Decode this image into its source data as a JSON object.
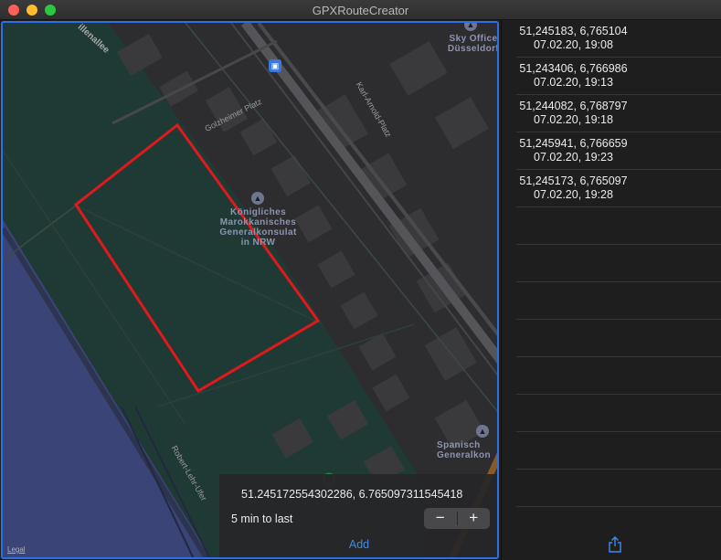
{
  "window": {
    "title": "GPXRouteCreator"
  },
  "map": {
    "labels": {
      "consulate": [
        "Königliches",
        "Marokkanisches",
        "Generalkonsulat",
        "in NRW"
      ],
      "sky_office": [
        "Sky Office",
        "Düsseldorf"
      ],
      "spanish": [
        "Spanisch",
        "Generalkon"
      ]
    },
    "streets": {
      "allee": "illenallee",
      "golzheimer": "Golzheimer Platz",
      "karl_arnold": "Karl-Arnold-Platz",
      "robert_lehr": "Robert-Lehr-Ufer"
    },
    "legal": "Legal",
    "colors": {
      "route": "#e0191c",
      "accent": "#2f6fe6",
      "water": "#3a4476",
      "park": "#1f3a35"
    }
  },
  "overlay": {
    "coordinate": "51.245172554302286, 6.765097311545418",
    "interval": "5 min to last",
    "stepper_minus": "−",
    "stepper_plus": "+",
    "add_label": "Add"
  },
  "waypoints": [
    {
      "coord": "51,245183, 6,765104",
      "time": "07.02.20, 19:08"
    },
    {
      "coord": "51,243406, 6,766986",
      "time": "07.02.20, 19:13"
    },
    {
      "coord": "51,244082, 6,768797",
      "time": "07.02.20, 19:18"
    },
    {
      "coord": "51,245941, 6,766659",
      "time": "07.02.20, 19:23"
    },
    {
      "coord": "51,245173, 6,765097",
      "time": "07.02.20, 19:28"
    }
  ],
  "icons": {
    "share": "share-icon",
    "poi": "landmark-icon",
    "transit": "transit-icon"
  }
}
